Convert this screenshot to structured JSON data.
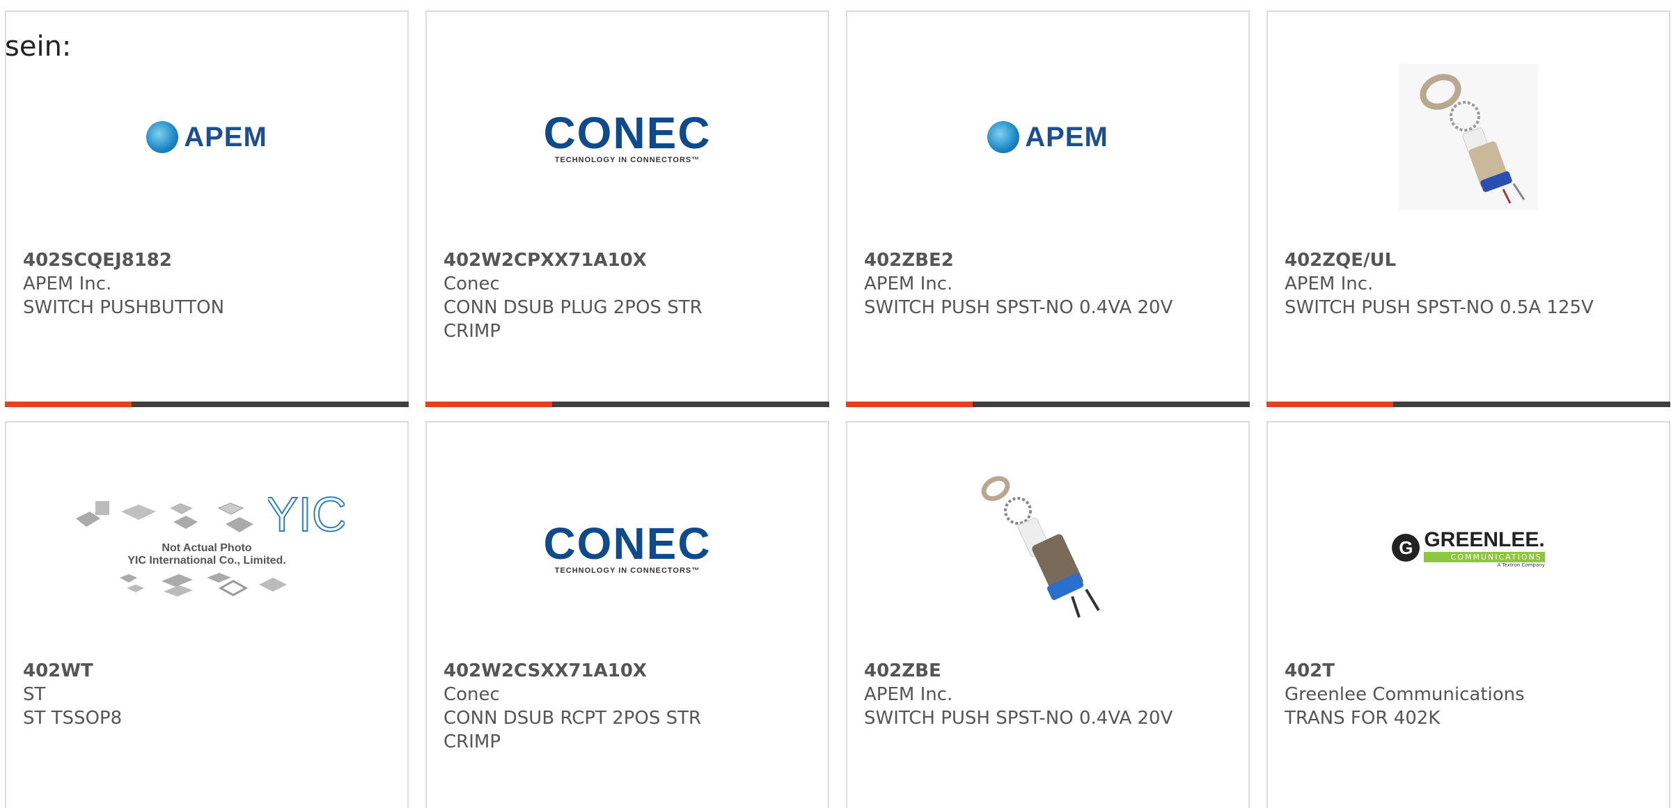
{
  "prefix_text": "sein:",
  "cards": [
    {
      "part": "402SCQEJ8182",
      "manufacturer": "APEM Inc.",
      "description": "SWITCH PUSHBUTTON",
      "logo": "APEM"
    },
    {
      "part": "402W2CPXX71A10X",
      "manufacturer": "Conec",
      "description": "CONN DSUB PLUG 2POS STR CRIMP",
      "logo": "CONEC",
      "logo_sub": "TECHNOLOGY IN CONNECTORS™"
    },
    {
      "part": "402ZBE2",
      "manufacturer": "APEM Inc.",
      "description": "SWITCH PUSH SPST-NO 0.4VA 20V",
      "logo": "APEM"
    },
    {
      "part": "402ZQE/UL",
      "manufacturer": "APEM Inc.",
      "description": "SWITCH PUSH SPST-NO 0.5A 125V"
    },
    {
      "part": "402WT",
      "manufacturer": "ST",
      "description": "ST TSSOP8",
      "image_text_1": "Not Actual Photo",
      "image_text_2": "YIC International Co., Limited."
    },
    {
      "part": "402W2CSXX71A10X",
      "manufacturer": "Conec",
      "description": "CONN DSUB RCPT 2POS STR CRIMP",
      "logo": "CONEC",
      "logo_sub": "TECHNOLOGY IN CONNECTORS™"
    },
    {
      "part": "402ZBE",
      "manufacturer": "APEM Inc.",
      "description": "SWITCH PUSH SPST-NO 0.4VA 20V"
    },
    {
      "part": "402T",
      "manufacturer": "Greenlee Communications",
      "description": "TRANS FOR 402K",
      "logo": "GREENLEE.",
      "logo_sub": "COMMUNICATIONS",
      "logo_tag": "A Textron Company"
    }
  ],
  "colors": {
    "accent": "#e6411e",
    "bar": "#3f3f3f",
    "text": "#555555",
    "border": "#dcdcdc"
  }
}
